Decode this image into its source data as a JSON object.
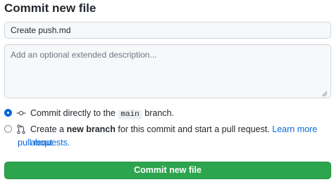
{
  "page_title": "Commit new file",
  "commit_summary": {
    "value": "Create push.md"
  },
  "commit_description": {
    "placeholder": "Add an optional extended description..."
  },
  "options": {
    "direct": {
      "selected": true,
      "prefix": "Commit directly to the",
      "branch": "main",
      "suffix": "branch."
    },
    "new_branch": {
      "selected": false,
      "prefix": "Create a",
      "bold": "new branch",
      "rest": "for this commit and start a pull request.",
      "link_line1": "Learn more about",
      "link_line2": "pull requests."
    }
  },
  "commit_button_label": "Commit new file",
  "colors": {
    "accent": "#0969da",
    "button": "#2da44e"
  }
}
